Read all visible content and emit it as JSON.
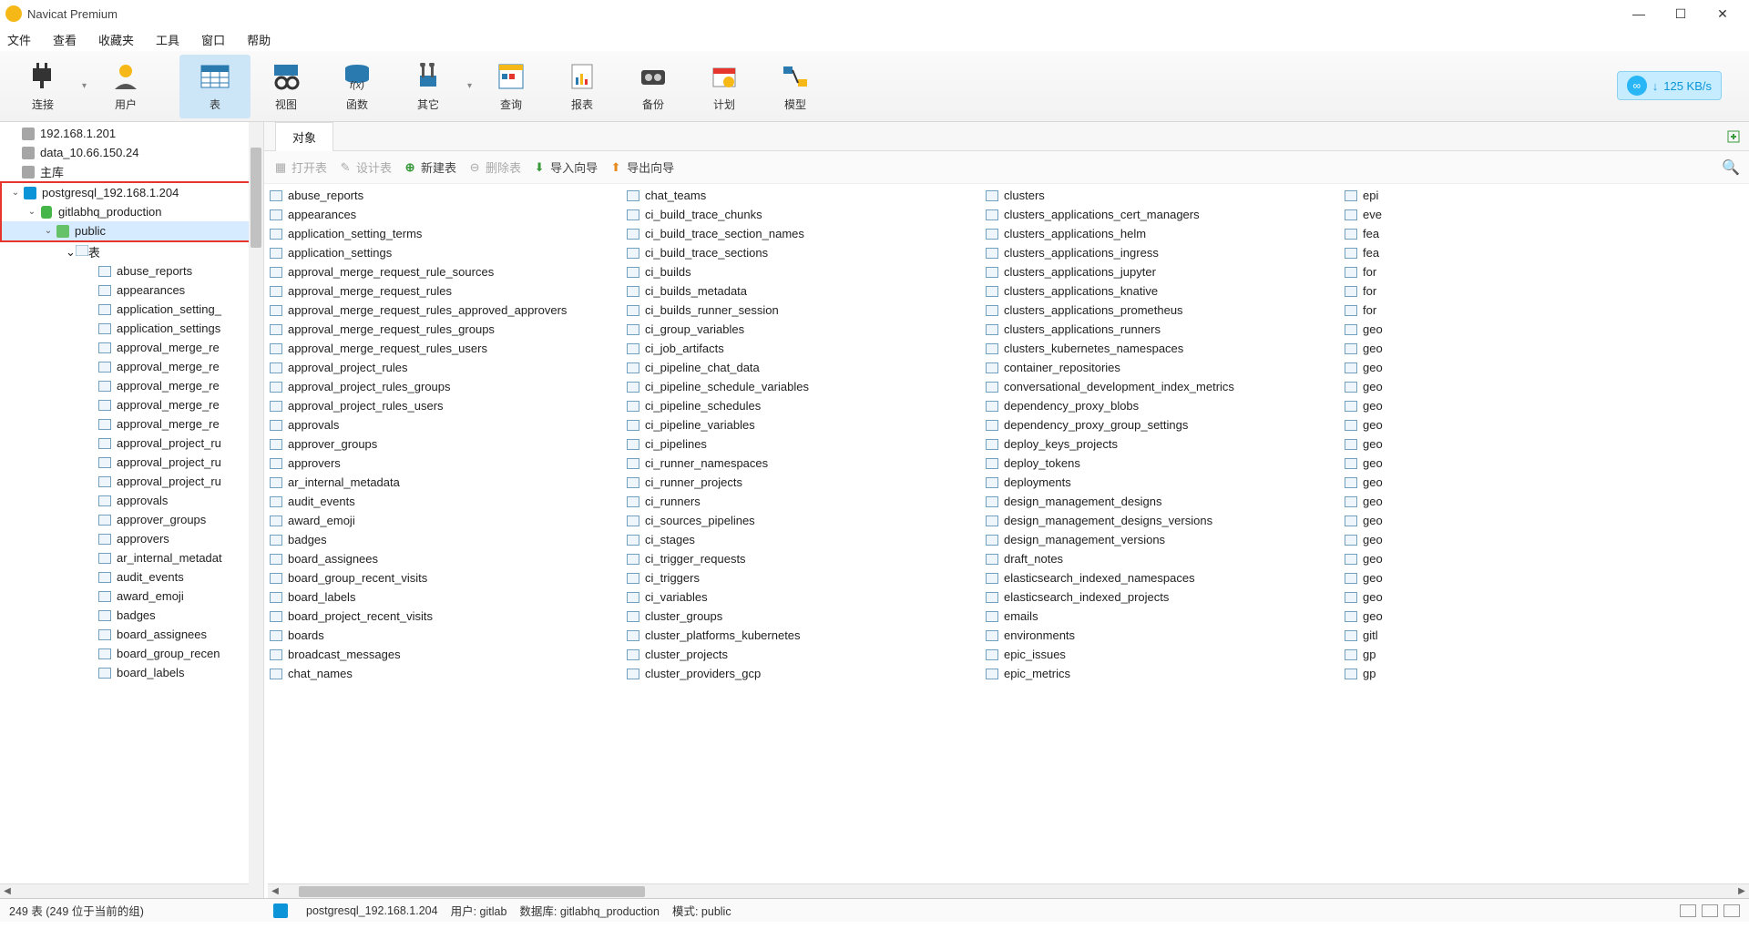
{
  "app": {
    "title": "Navicat Premium"
  },
  "menu": {
    "file": "文件",
    "view": "查看",
    "fav": "收藏夹",
    "tool": "工具",
    "window": "窗口",
    "help": "帮助"
  },
  "toolbar": {
    "connect": "连接",
    "user": "用户",
    "table": "表",
    "view": "视图",
    "function": "函数",
    "other": "其它",
    "query": "查询",
    "report": "报表",
    "backup": "备份",
    "plan": "计划",
    "model": "模型",
    "speed": "125 KB/s"
  },
  "connections": {
    "c0": "192.168.1.201",
    "c1": "data_10.66.150.24",
    "c2": "主库",
    "c3": "postgresql_192.168.1.204",
    "db": "gitlabhq_production",
    "schema": "public",
    "tablesLabel": "表"
  },
  "sidebarTables": [
    "abuse_reports",
    "appearances",
    "application_setting_",
    "application_settings",
    "approval_merge_re",
    "approval_merge_re",
    "approval_merge_re",
    "approval_merge_re",
    "approval_merge_re",
    "approval_project_ru",
    "approval_project_ru",
    "approval_project_ru",
    "approvals",
    "approver_groups",
    "approvers",
    "ar_internal_metadat",
    "audit_events",
    "award_emoji",
    "badges",
    "board_assignees",
    "board_group_recen",
    "board_labels"
  ],
  "tab": {
    "objects": "对象"
  },
  "objbar": {
    "open": "打开表",
    "design": "设计表",
    "new": "新建表",
    "delete": "删除表",
    "import": "导入向导",
    "export": "导出向导"
  },
  "tablesCol0": [
    "abuse_reports",
    "appearances",
    "application_setting_terms",
    "application_settings",
    "approval_merge_request_rule_sources",
    "approval_merge_request_rules",
    "approval_merge_request_rules_approved_approvers",
    "approval_merge_request_rules_groups",
    "approval_merge_request_rules_users",
    "approval_project_rules",
    "approval_project_rules_groups",
    "approval_project_rules_users",
    "approvals",
    "approver_groups",
    "approvers",
    "ar_internal_metadata",
    "audit_events",
    "award_emoji",
    "badges",
    "board_assignees",
    "board_group_recent_visits",
    "board_labels",
    "board_project_recent_visits",
    "boards",
    "broadcast_messages",
    "chat_names"
  ],
  "tablesCol1": [
    "chat_teams",
    "ci_build_trace_chunks",
    "ci_build_trace_section_names",
    "ci_build_trace_sections",
    "ci_builds",
    "ci_builds_metadata",
    "ci_builds_runner_session",
    "ci_group_variables",
    "ci_job_artifacts",
    "ci_pipeline_chat_data",
    "ci_pipeline_schedule_variables",
    "ci_pipeline_schedules",
    "ci_pipeline_variables",
    "ci_pipelines",
    "ci_runner_namespaces",
    "ci_runner_projects",
    "ci_runners",
    "ci_sources_pipelines",
    "ci_stages",
    "ci_trigger_requests",
    "ci_triggers",
    "ci_variables",
    "cluster_groups",
    "cluster_platforms_kubernetes",
    "cluster_projects",
    "cluster_providers_gcp"
  ],
  "tablesCol2": [
    "clusters",
    "clusters_applications_cert_managers",
    "clusters_applications_helm",
    "clusters_applications_ingress",
    "clusters_applications_jupyter",
    "clusters_applications_knative",
    "clusters_applications_prometheus",
    "clusters_applications_runners",
    "clusters_kubernetes_namespaces",
    "container_repositories",
    "conversational_development_index_metrics",
    "dependency_proxy_blobs",
    "dependency_proxy_group_settings",
    "deploy_keys_projects",
    "deploy_tokens",
    "deployments",
    "design_management_designs",
    "design_management_designs_versions",
    "design_management_versions",
    "draft_notes",
    "elasticsearch_indexed_namespaces",
    "elasticsearch_indexed_projects",
    "emails",
    "environments",
    "epic_issues",
    "epic_metrics"
  ],
  "tablesCol3": [
    "epi",
    "eve",
    "fea",
    "fea",
    "for",
    "for",
    "for",
    "geo",
    "geo",
    "geo",
    "geo",
    "geo",
    "geo",
    "geo",
    "geo",
    "geo",
    "geo",
    "geo",
    "geo",
    "geo",
    "geo",
    "geo",
    "geo",
    "gitl",
    "gp",
    "gp"
  ],
  "status": {
    "count": "249 表 (249 位于当前的组)",
    "conn": "postgresql_192.168.1.204",
    "user": "用户: gitlab",
    "db": "数据库: gitlabhq_production",
    "schema": "模式: public"
  }
}
